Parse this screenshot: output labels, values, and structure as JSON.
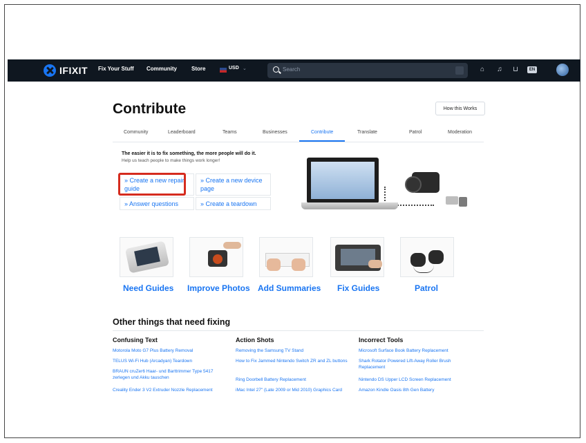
{
  "nav": {
    "logo": "IFIXIT",
    "links": [
      "Fix Your Stuff",
      "Community",
      "Store"
    ],
    "currency": "USD",
    "search_placeholder": "Search",
    "lang_badge": "EN"
  },
  "page": {
    "title": "Contribute",
    "how_button": "How this Works"
  },
  "tabs": [
    "Community",
    "Leaderboard",
    "Teams",
    "Businesses",
    "Contribute",
    "Translate",
    "Patrol",
    "Moderation"
  ],
  "intro": {
    "headline": "The easier it is to fix something, the more people will do it.",
    "sub": "Help us teach people to make things work longer!"
  },
  "actions": {
    "create_guide": "» Create a new repair guide",
    "create_device": "» Create a new device page",
    "answer": "» Answer questions",
    "teardown": "» Create a teardown"
  },
  "features": [
    "Need Guides",
    "Improve Photos",
    "Add Summaries",
    "Fix Guides",
    "Patrol"
  ],
  "other": {
    "heading": "Other things that need fixing",
    "columns": [
      {
        "title": "Confusing Text",
        "links": [
          "Motorola Moto G7 Plus Battery Removal",
          "TELUS Wi-Fi Hub (Arcadyan) Teardown",
          "BRAUN cruZer6 Haar- und Barttrimmer Type 5417 zerlegen und Akku tauschen",
          "Creality Ender 3 V2 Extruder Nozzle Replacement"
        ]
      },
      {
        "title": "Action Shots",
        "links": [
          "Removing the Samsung TV Stand",
          "How to Fix Jammed Nintendo Switch ZR and ZL buttons",
          "Ring Doorbell Battery Replacement",
          "iMac Intel 27\" (Late 2009 or Mid 2010) Graphics Card Replacement"
        ]
      },
      {
        "title": "Incorrect Tools",
        "links": [
          "Microsoft Surface Book Battery Replacement",
          "Shark Rotator Powered Lift-Away Roller Brush Replacement",
          "Nintendo DS Upper LCD Screen Replacement",
          "Amazon Kindle Oasis 8th Gen Battery Replacement"
        ]
      }
    ]
  },
  "colors": {
    "nav_bg": "#0f1720",
    "accent": "#1975f2",
    "highlight": "#d52b1e"
  }
}
